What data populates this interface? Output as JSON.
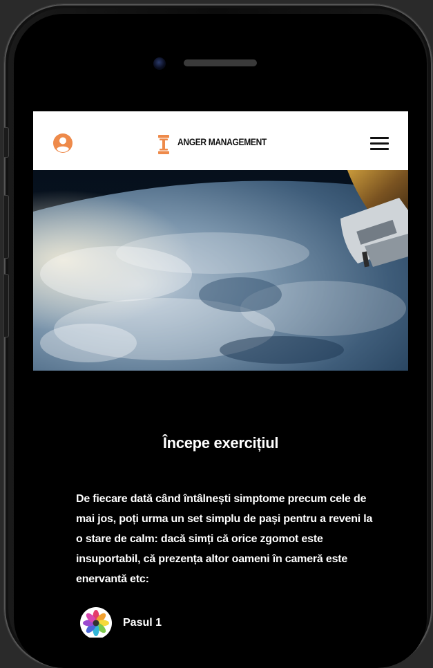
{
  "header": {
    "brand": "ANGER MANAGEMENT",
    "accent_color": "#ee8a4a",
    "icons": {
      "user": "user-circle-icon",
      "logo": "dumbbell-icon",
      "menu": "hamburger-menu-icon"
    }
  },
  "hero": {
    "image": "earth-from-space-with-satellite"
  },
  "main": {
    "title": "Începe exercițiul",
    "paragraph": "De fiecare dată când întâlnești simptome precum cele de mai jos, poți urma un set simplu de pași pentru a reveni la o stare de calm: dacă simți că orice zgomot este insuportabil, că prezența altor oameni în cameră este enervantă etc:",
    "steps": [
      {
        "label": "Pasul 1",
        "icon": "flower-avatar-icon"
      }
    ]
  }
}
